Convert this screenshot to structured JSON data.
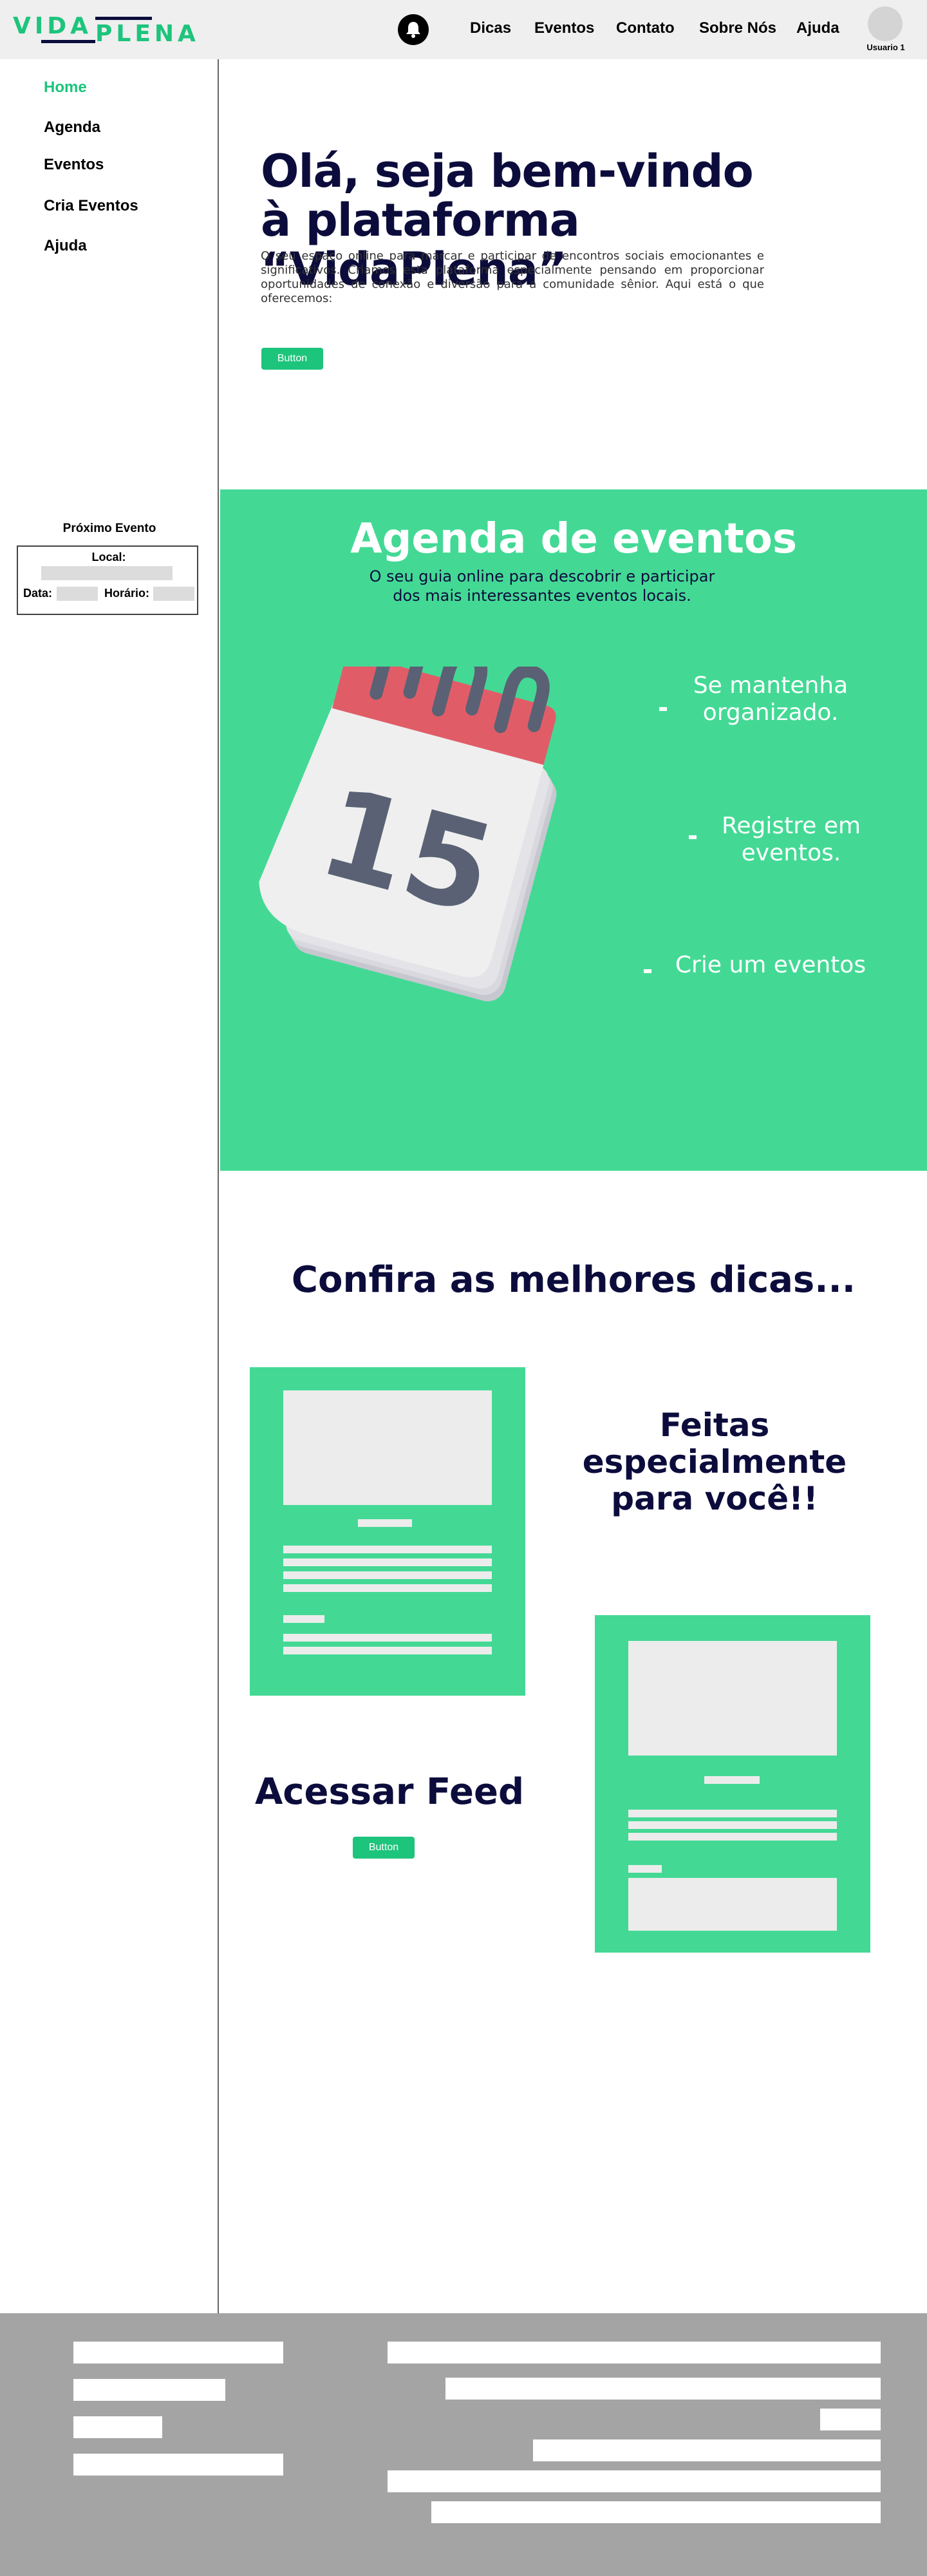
{
  "header": {
    "logo_part1": "VIDA",
    "logo_part2": "PLENA",
    "nav": [
      "Dicas",
      "Eventos",
      "Contato",
      "Sobre Nós",
      "Ajuda"
    ],
    "user_label": "Usuario 1"
  },
  "sidebar": {
    "items": [
      "Home",
      "Agenda",
      "Eventos",
      "Cria Eventos",
      "Ajuda"
    ],
    "next_event": {
      "title": "Próximo Evento",
      "local_label": "Local:",
      "date_label": "Data:",
      "time_label": "Horário:"
    }
  },
  "hero": {
    "title": "Olá, seja bem-vindo à plataforma “VidaPlena”",
    "text": "O seu espaço online para marcar e participar de encontros sociais emocionantes e significativos. Criamos esta plataforma especialmente pensando em proporcionar oportunidades de conexão e diversão para a comunidade sênior. Aqui está o que oferecemos:",
    "button": "Button"
  },
  "agenda": {
    "title": "Agenda de eventos",
    "subtitle": "O seu guia online para descobrir e participar dos mais interessantes eventos locais.",
    "calendar_number": "15",
    "features": [
      "Se mantenha organizado.",
      "Registre em eventos.",
      "Crie um eventos"
    ]
  },
  "tips": {
    "title": "Confira as melhores dicas...",
    "special": "Feitas especialmente para você!!",
    "feed_title": "Acessar Feed",
    "feed_button": "Button"
  },
  "colors": {
    "accent": "#1dc47c",
    "section_green": "#43d995",
    "navy": "#0c0c3c",
    "footer": "#a4a4a4"
  }
}
